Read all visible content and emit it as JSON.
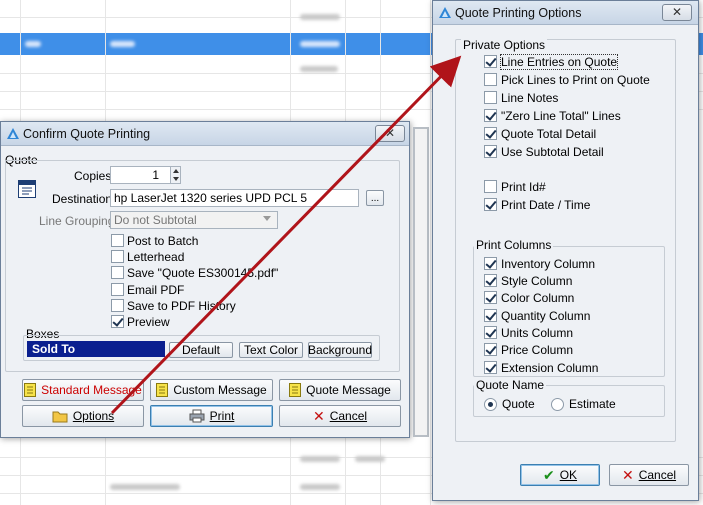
{
  "confirm_dialog": {
    "title": "Confirm Quote Printing",
    "close_glyph": "✕",
    "group_label": "Quote",
    "copies_label": "Copies",
    "copies_value": "1",
    "destination_label": "Destination",
    "destination_value": "hp LaserJet 1320 series UPD PCL 5",
    "browse_label": "...",
    "line_grouping_label": "Line Grouping",
    "line_grouping_value": "Do not Subtotal",
    "options": [
      {
        "label": "Post to Batch",
        "checked": false
      },
      {
        "label": "Letterhead",
        "checked": false
      },
      {
        "label": "Save \"Quote ES300145.pdf\"",
        "checked": false
      },
      {
        "label": "Email PDF",
        "checked": false
      },
      {
        "label": "Save to PDF History",
        "checked": false
      },
      {
        "label": "Preview",
        "checked": true
      }
    ],
    "boxes_label": "Boxes",
    "boxes_value": "Sold To",
    "default_label": "Default",
    "text_color_label": "Text Color",
    "background_label": "Background",
    "standard_message_label": "Standard Message",
    "custom_message_label": "Custom Message",
    "quote_message_label": "Quote Message",
    "options_label": "Options",
    "print_label": "Print",
    "cancel_label": "Cancel"
  },
  "options_dialog": {
    "title": "Quote Printing Options",
    "close_glyph": "✕",
    "private_options_label": "Private Options",
    "private_options": [
      {
        "label": "Line Entries on Quote",
        "checked": true
      },
      {
        "label": "Pick Lines to Print on Quote",
        "checked": false
      },
      {
        "label": "Line Notes",
        "checked": false
      },
      {
        "label": "\"Zero Line Total\" Lines",
        "checked": true
      },
      {
        "label": "Quote Total Detail",
        "checked": true
      },
      {
        "label": "Use Subtotal Detail",
        "checked": true
      },
      {
        "label": "Print Id#",
        "checked": false
      },
      {
        "label": "Print Date / Time",
        "checked": true
      }
    ],
    "print_columns_label": "Print Columns",
    "print_columns": [
      {
        "label": "Inventory Column",
        "checked": true
      },
      {
        "label": "Style Column",
        "checked": true
      },
      {
        "label": "Color Column",
        "checked": true
      },
      {
        "label": "Quantity Column",
        "checked": true
      },
      {
        "label": "Units Column",
        "checked": true
      },
      {
        "label": "Price Column",
        "checked": true
      },
      {
        "label": "Extension Column",
        "checked": true
      }
    ],
    "quote_name_label": "Quote Name",
    "quote_name_options": [
      {
        "label": "Quote",
        "selected": true
      },
      {
        "label": "Estimate",
        "selected": false
      }
    ],
    "ok_label": "OK",
    "cancel_label": "Cancel"
  },
  "colors": {
    "selected_row": "#3f8fe8",
    "boxes_fill": "#0a1f8f",
    "arrow": "#b0141a",
    "standard_message_text": "#cc0000"
  }
}
